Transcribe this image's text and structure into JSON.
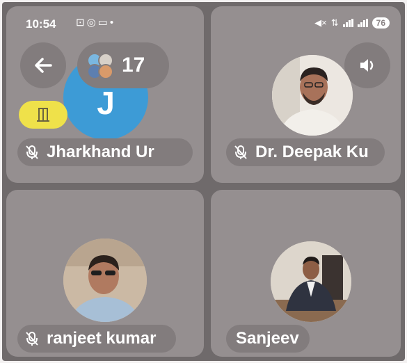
{
  "status_bar": {
    "time": "10:54",
    "battery": "76",
    "left_icons": [
      "screen-record-icon",
      "whatsapp-icon",
      "video-icon",
      "dot-icon"
    ],
    "right_icons": [
      "mute-icon",
      "data-icon",
      "signal-icon",
      "signal-icon"
    ]
  },
  "call": {
    "participant_count": "17",
    "participants": [
      {
        "name": "Jharkhand Ur",
        "avatar_letter": "J",
        "avatar_color": "#3d9bd6",
        "muted": true
      },
      {
        "name": "Dr. Deepak Ku",
        "muted": true
      },
      {
        "name": "ranjeet kumar",
        "muted": true
      },
      {
        "name": "Sanjeev",
        "muted": false
      }
    ]
  },
  "colors": {
    "tile": "#958f90",
    "button": "#827c7d",
    "door_badge": "#efe14a",
    "avatar_blue": "#3d9bd6"
  }
}
